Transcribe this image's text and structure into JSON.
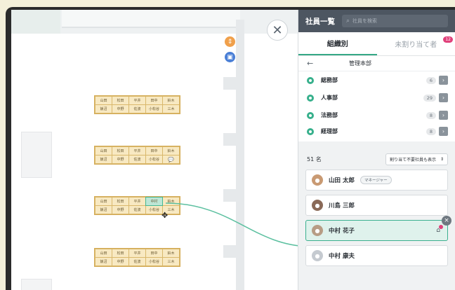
{
  "close_label": "✕",
  "panel": {
    "title": "社員一覧",
    "search_placeholder": "社員を検索",
    "tabs": [
      {
        "label": "組織別",
        "active": true
      },
      {
        "label": "未割り当て者",
        "badge": "12"
      }
    ],
    "dept_header": "管理本部",
    "departments": [
      {
        "name": "総務部",
        "count": "6"
      },
      {
        "name": "人事部",
        "count": "29"
      },
      {
        "name": "法務部",
        "count": "8"
      },
      {
        "name": "経理部",
        "count": "8"
      }
    ],
    "member_count": "51 名",
    "filter_label": "割り当て不要社員も表示",
    "members": [
      {
        "name": "山田 太郎",
        "role": "マネージャー"
      },
      {
        "name": "川島 三郎"
      },
      {
        "name": "中村 花子",
        "selected": true
      },
      {
        "name": "中村 康夫"
      }
    ]
  },
  "desk_groups": [
    {
      "row1": [
        "山田",
        "松田",
        "平井",
        "田中",
        "鈴木"
      ],
      "row2": [
        "飯沼",
        "中野",
        "佐波",
        "小松谷",
        "三木"
      ]
    },
    {
      "row1": [
        "山田",
        "松田",
        "平井",
        "田中",
        "鈴木"
      ],
      "row2": [
        "飯沼",
        "中野",
        "佐波",
        "小松谷",
        "💬"
      ]
    },
    {
      "row1": [
        "山田",
        "松田",
        "平井",
        "中村",
        "鈴木"
      ],
      "row2": [
        "飯沼",
        "中野",
        "佐波",
        "小松谷",
        "三木"
      ]
    },
    {
      "row1": [
        "山田",
        "松田",
        "平井",
        "田中",
        "鈴木"
      ],
      "row2": [
        "飯沼",
        "中野",
        "佐波",
        "小松谷",
        "三木"
      ]
    }
  ],
  "colors": {
    "accent": "#37b08c",
    "header": "#4d5661",
    "badge": "#e0407a",
    "desk": "#f8e9c2"
  },
  "icons": {
    "close": "close-icon",
    "search": "search-icon",
    "back": "arrow-left-icon",
    "chevron": "chevron-right-icon",
    "seat": "seat-icon"
  }
}
